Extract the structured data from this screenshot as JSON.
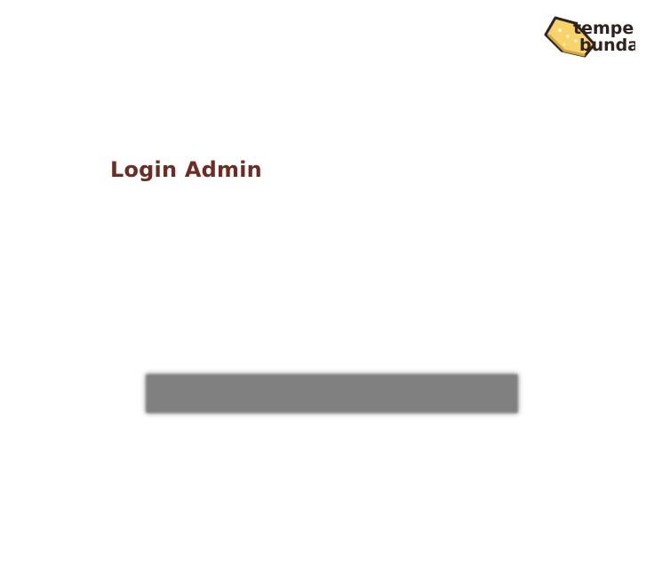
{
  "logo": {
    "line1": "tempe",
    "line2": "bunda",
    "colors": {
      "block": "#f6d36b",
      "block_stroke": "#2f231f",
      "text": "#2f231f"
    }
  },
  "header": {
    "title": "Login Admin"
  },
  "placeholders": {
    "blurred_bar": "#808080"
  },
  "colors": {
    "background": "#ffffff",
    "title": "#6b2d24"
  }
}
